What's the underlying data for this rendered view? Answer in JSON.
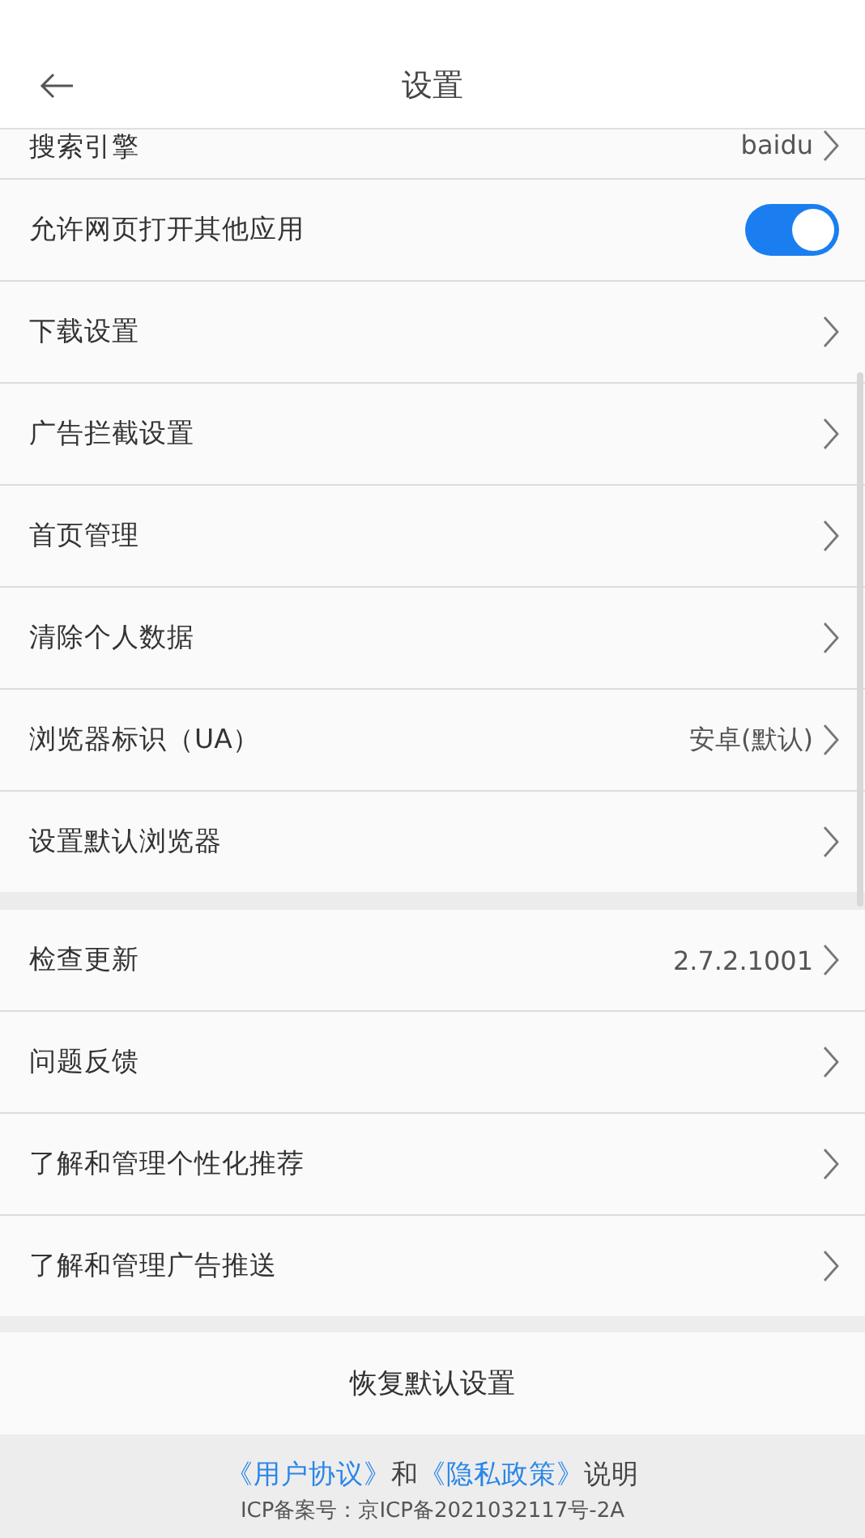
{
  "header": {
    "title": "设置"
  },
  "sections": [
    {
      "partial_first": true,
      "items": [
        {
          "kind": "chevron",
          "label": "搜索引擎",
          "value": "baidu"
        },
        {
          "kind": "toggle",
          "label": "允许网页打开其他应用",
          "on": true
        },
        {
          "kind": "chevron",
          "label": "下载设置"
        },
        {
          "kind": "chevron",
          "label": "广告拦截设置"
        },
        {
          "kind": "chevron",
          "label": "首页管理"
        },
        {
          "kind": "chevron",
          "label": "清除个人数据"
        },
        {
          "kind": "chevron",
          "label": "浏览器标识（UA）",
          "value": "安卓(默认)"
        },
        {
          "kind": "chevron",
          "label": "设置默认浏览器"
        }
      ]
    },
    {
      "partial_first": false,
      "items": [
        {
          "kind": "chevron",
          "label": "检查更新",
          "value": "2.7.2.1001"
        },
        {
          "kind": "chevron",
          "label": "问题反馈"
        },
        {
          "kind": "chevron",
          "label": "了解和管理个性化推荐"
        },
        {
          "kind": "chevron",
          "label": "了解和管理广告推送"
        }
      ]
    }
  ],
  "restore_button": "恢复默认设置",
  "footer": {
    "parts": [
      {
        "kind": "link",
        "text": "《用户协议》"
      },
      {
        "kind": "text",
        "text": "和"
      },
      {
        "kind": "link",
        "text": "《隐私政策》"
      },
      {
        "kind": "text",
        "text": "说明"
      }
    ],
    "icp": "ICP备案号：京ICP备2021032117号-2A"
  }
}
